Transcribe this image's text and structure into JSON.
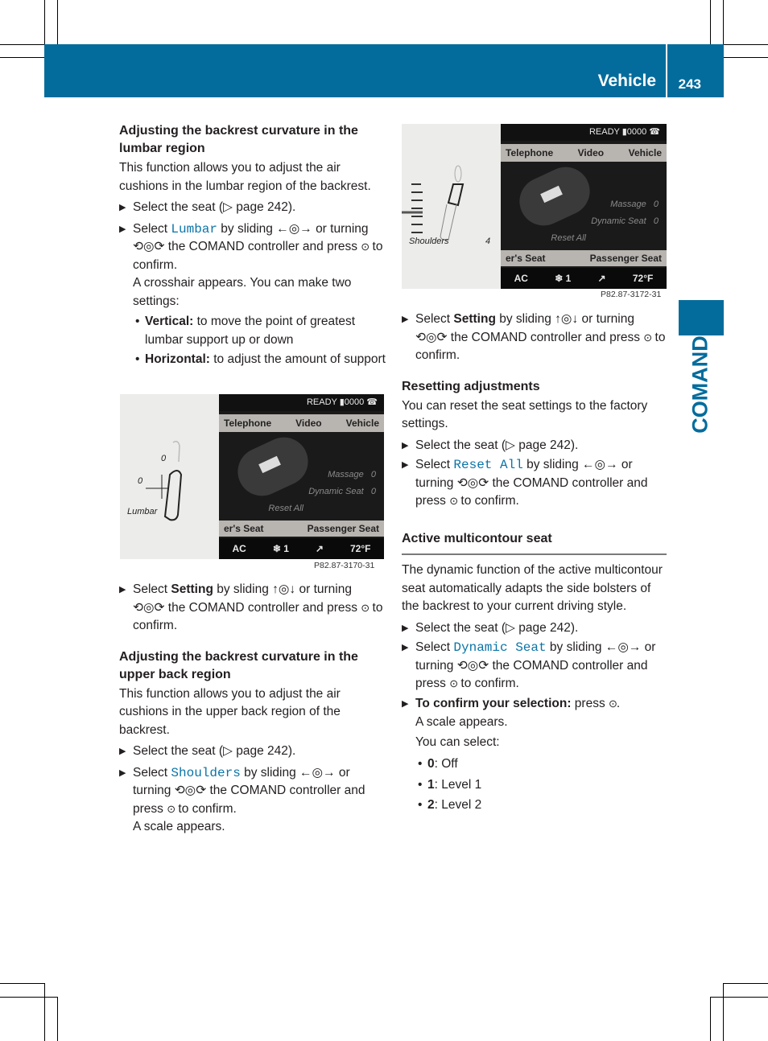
{
  "header": {
    "section": "Vehicle",
    "page_number": "243"
  },
  "side_tab": {
    "label": "COMAND"
  },
  "left_column": {
    "lumbar": {
      "heading": "Adjusting the backrest curvature in the lumbar region",
      "intro": "This function allows you to adjust the air cushions in the lumbar region of the backrest.",
      "step1": "Select the seat (▷ page 242).",
      "step2_pre": "Select ",
      "step2_keyword": "Lumbar",
      "step2_mid": " by sliding ←◎→ or turning ⟲◎⟳ the COMAND controller and press ",
      "step2_post": " to confirm.",
      "step2_note": "A crosshair appears. You can make two settings:",
      "bullets": [
        {
          "label": "Vertical:",
          "text": " to move the point of greatest lumbar support up or down"
        },
        {
          "label": "Horizontal:",
          "text": " to adjust the amount of support"
        }
      ]
    },
    "figure1": {
      "status": "READY ▮0000 ☎",
      "menu": [
        "Telephone",
        "Video",
        "Vehicle"
      ],
      "options": [
        {
          "label": "Massage",
          "value": "0"
        },
        {
          "label": "Dynamic Seat",
          "value": "0"
        },
        {
          "label": "Reset All",
          "value": ""
        }
      ],
      "seat_tabs": [
        "er's Seat",
        "Passenger Seat"
      ],
      "climate": [
        "AC",
        "❄ 1",
        "↗",
        "72°F"
      ],
      "left_values": [
        "0",
        "0"
      ],
      "left_caption": "Lumbar",
      "code": "P82.87-3170-31"
    },
    "setting_step": {
      "pre": "Select ",
      "keyword": "Setting",
      "mid": " by sliding ↑◎↓ or turning ⟲◎⟳ the COMAND controller and press ",
      "post": " to confirm."
    },
    "upper": {
      "heading": "Adjusting the backrest curvature in the upper back region",
      "intro": "This function allows you to adjust the air cushions in the upper back region of the backrest.",
      "step1": "Select the seat (▷ page 242).",
      "step2_pre": "Select ",
      "step2_keyword": "Shoulders",
      "step2_mid": " by sliding ←◎→ or turning ⟲◎⟳ the COMAND controller and press ",
      "step2_post": " to confirm.",
      "step2_note": "A scale appears."
    }
  },
  "right_column": {
    "figure2": {
      "status": "READY ▮0000 ☎",
      "menu": [
        "Telephone",
        "Video",
        "Vehicle"
      ],
      "options": [
        {
          "label": "Massage",
          "value": "0"
        },
        {
          "label": "Dynamic Seat",
          "value": "0"
        },
        {
          "label": "Reset All",
          "value": ""
        }
      ],
      "seat_tabs": [
        "er's Seat",
        "Passenger Seat"
      ],
      "climate": [
        "AC",
        "❄ 1",
        "↗",
        "72°F"
      ],
      "left_caption": "Shoulders",
      "left_value": "4",
      "code": "P82.87-3172-31"
    },
    "setting_step": {
      "pre": "Select ",
      "keyword": "Setting",
      "mid": " by sliding ↑◎↓ or turning ⟲◎⟳ the COMAND controller and press ",
      "post": " to confirm."
    },
    "reset": {
      "heading": "Resetting adjustments",
      "intro": "You can reset the seat settings to the factory settings.",
      "step1": "Select the seat (▷ page 242).",
      "step2_pre": "Select ",
      "step2_keyword": "Reset All",
      "step2_mid": " by sliding ←◎→ or turning ⟲◎⟳ the COMAND controller and press ",
      "step2_post": " to confirm."
    },
    "multicontour": {
      "heading": "Active multicontour seat",
      "intro": "The dynamic function of the active multicontour seat automatically adapts the side bolsters of the backrest to your current driving style.",
      "step1": "Select the seat (▷ page 242).",
      "step2_pre": "Select ",
      "step2_keyword": "Dynamic Seat",
      "step2_mid": " by sliding ←◎→ or turning ⟲◎⟳ the COMAND controller and press ",
      "step2_post": " to confirm.",
      "step3_label": "To confirm your selection:",
      "step3_text": " press ",
      "step3_end": ".",
      "note1": "A scale appears.",
      "note2": "You can select:",
      "levels": [
        {
          "value": "0",
          "label": ": Off"
        },
        {
          "value": "1",
          "label": ": Level 1"
        },
        {
          "value": "2",
          "label": ": Level 2"
        }
      ]
    }
  },
  "icons": {
    "press": "⊙",
    "step_marker": "▶"
  },
  "colors": {
    "brand_blue": "#046c9c",
    "keyword_blue": "#0a74a8"
  }
}
